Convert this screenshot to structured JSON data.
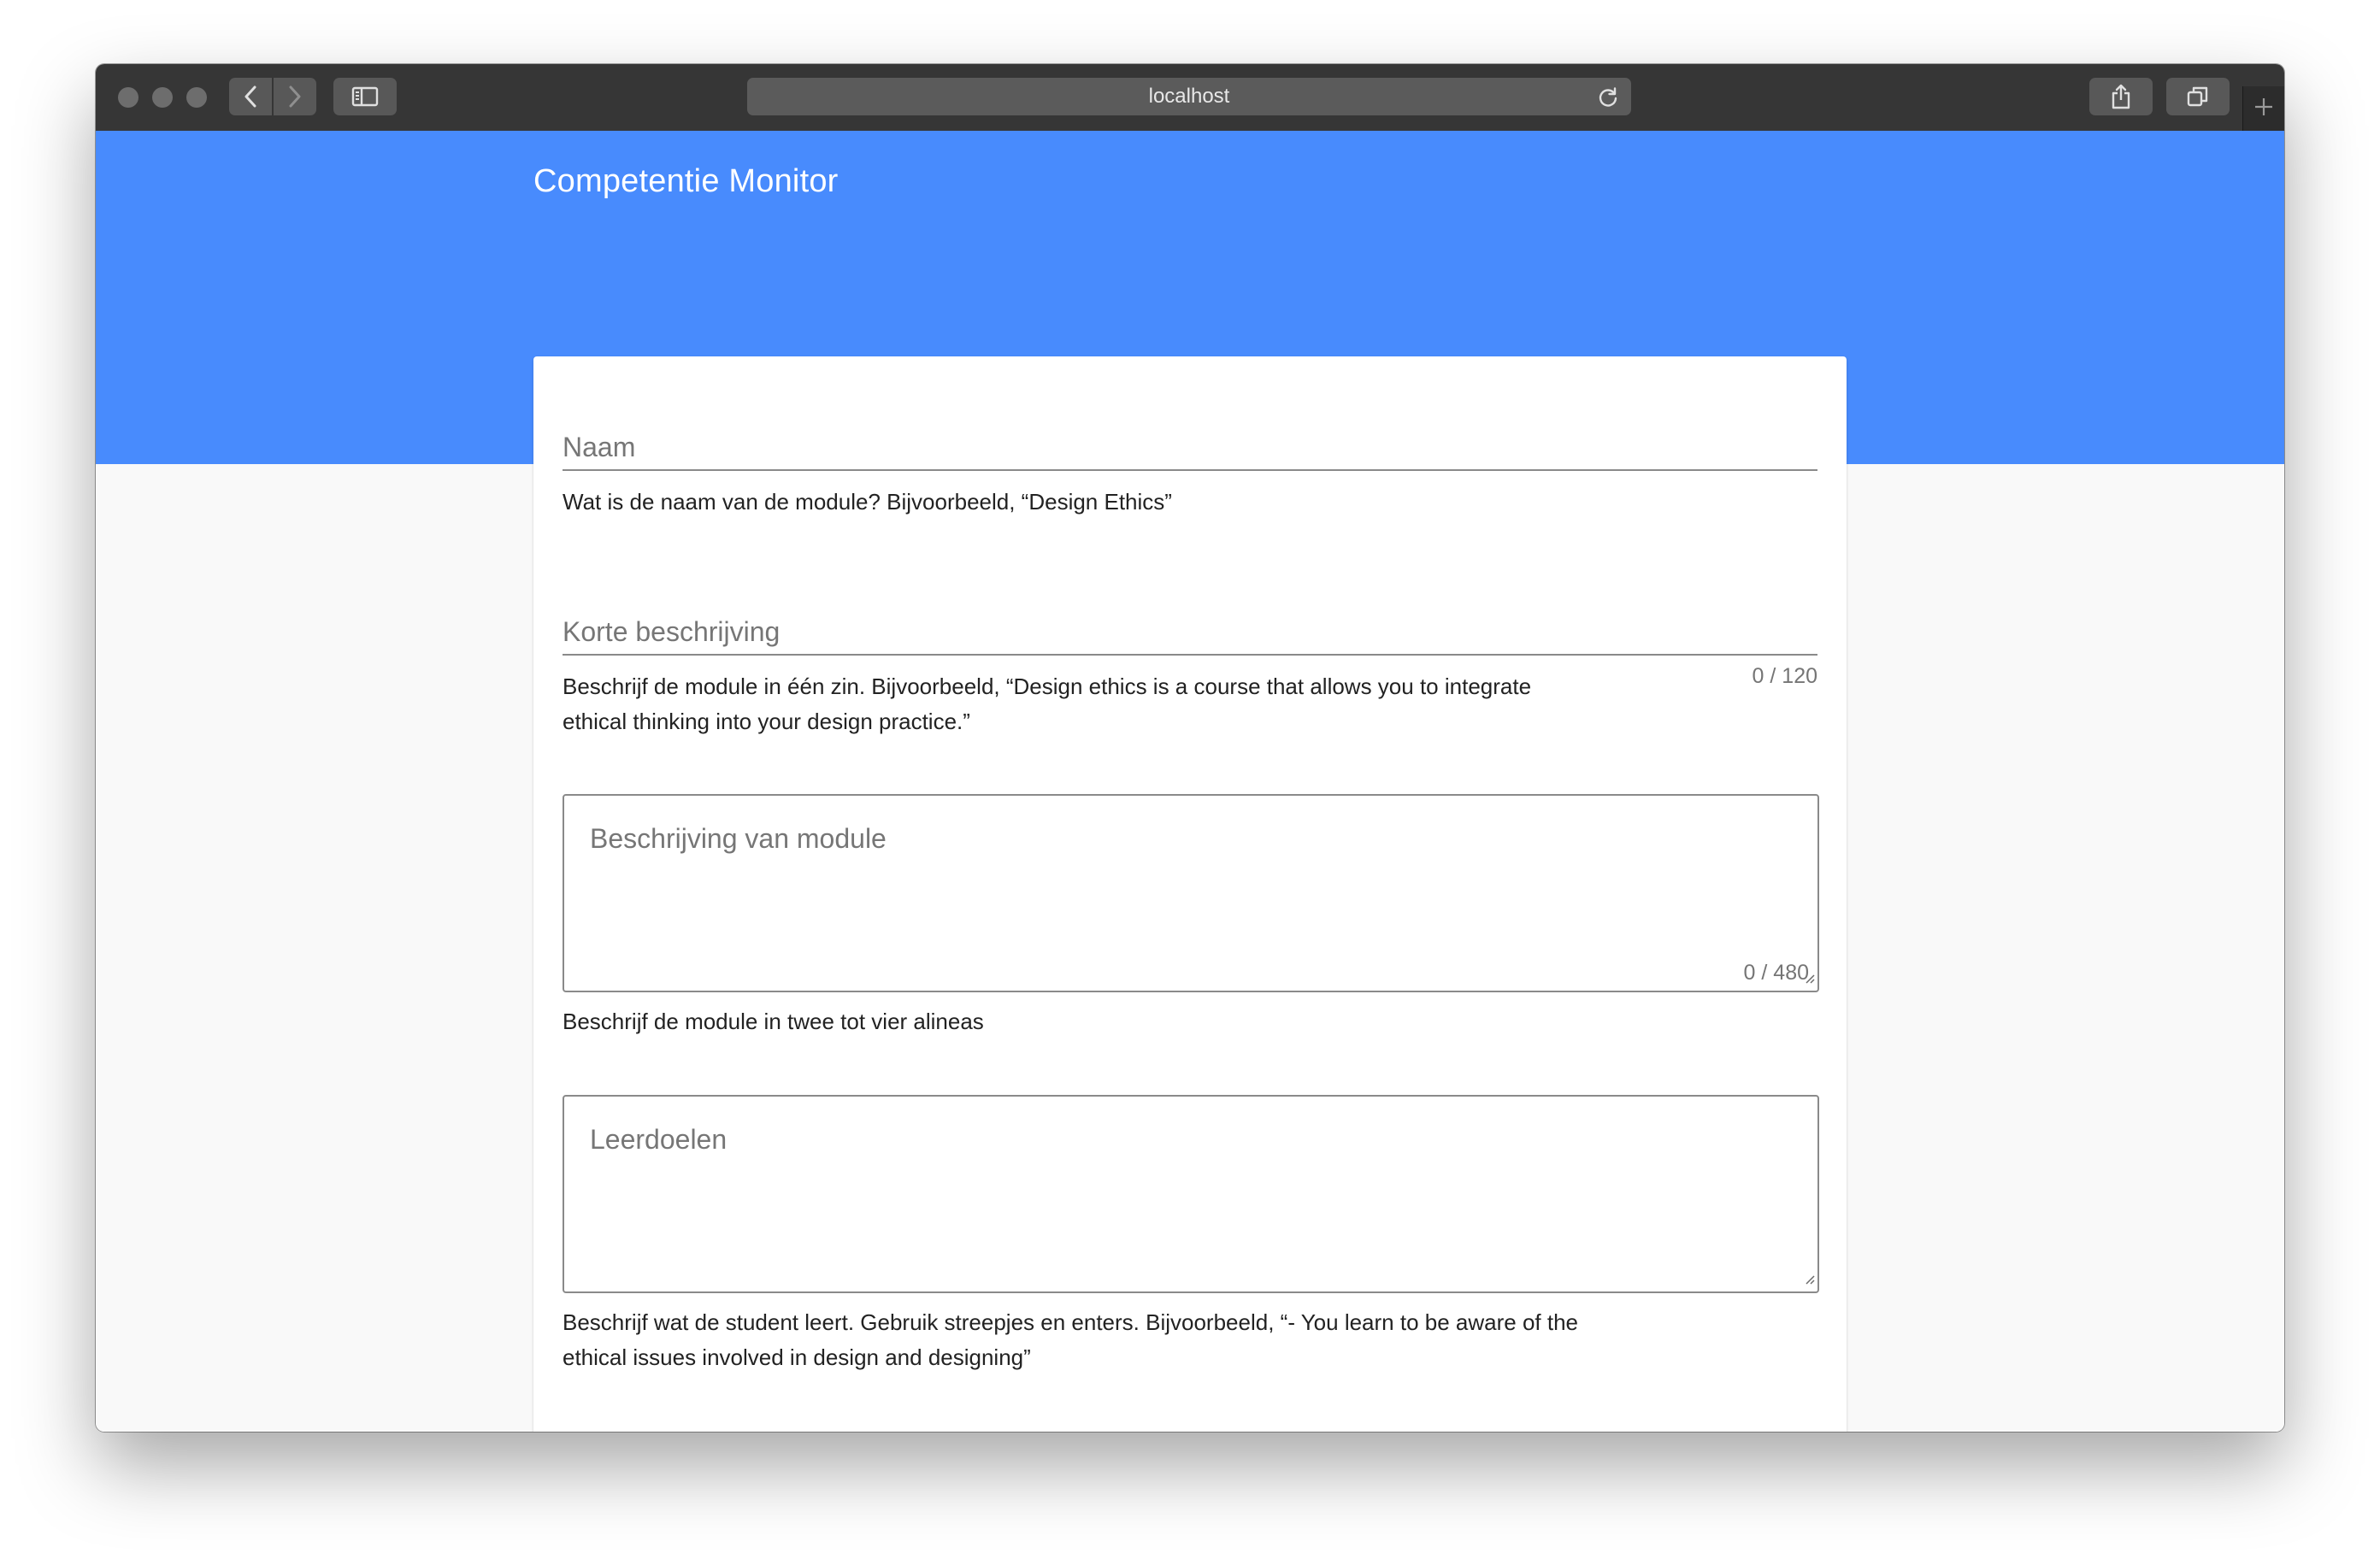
{
  "browser": {
    "url": "localhost",
    "icons": {
      "back": "chevron-left-icon",
      "forward": "chevron-right-icon",
      "sidebar": "sidebar-icon",
      "reload": "reload-icon",
      "share": "share-icon",
      "tabs": "tabs-overview-icon",
      "new_tab": "plus-icon"
    }
  },
  "colors": {
    "hero": "#488bfd",
    "titlebar": "#363636",
    "page_background": "#f9f9f9"
  },
  "app": {
    "title": "Competentie Monitor"
  },
  "form": {
    "naam": {
      "label": "Naam",
      "helper": "Wat is de naam van de module? Bijvoorbeeld, “Design Ethics”"
    },
    "korte_beschrijving": {
      "label": "Korte beschrijving",
      "counter": "0 / 120",
      "helper_line1": "Beschrijf de module in één zin. Bijvoorbeeld, “Design ethics is a course that allows you to integrate",
      "helper_line2": "ethical thinking into your design practice.”"
    },
    "beschrijving": {
      "label": "Beschrijving van module",
      "counter": "0 / 480",
      "helper": "Beschrijf de module in twee tot vier alineas"
    },
    "leerdoelen": {
      "label": "Leerdoelen",
      "helper_line1": "Beschrijf wat de student leert. Gebruik streepjes en enters. Bijvoorbeeld, “- You learn to be aware of the",
      "helper_line2": "ethical issues involved in design and designing”"
    }
  }
}
